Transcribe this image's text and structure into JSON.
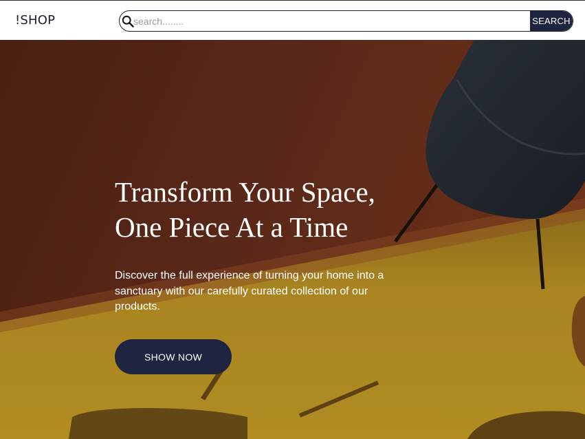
{
  "header": {
    "logo": "!SHOP",
    "search": {
      "placeholder": "search........",
      "button_label": "SEARCH"
    }
  },
  "hero": {
    "title_line1": "Transform Your Space,",
    "title_line2": "One Piece At a Time",
    "description": "Discover the full experience of turning your home into a sanctuary with our carefully curated collection of our products.",
    "cta_label": "SHOW NOW"
  },
  "colors": {
    "accent": "#1f2440",
    "wall": "#5a2a18",
    "floor": "#a9841e"
  }
}
